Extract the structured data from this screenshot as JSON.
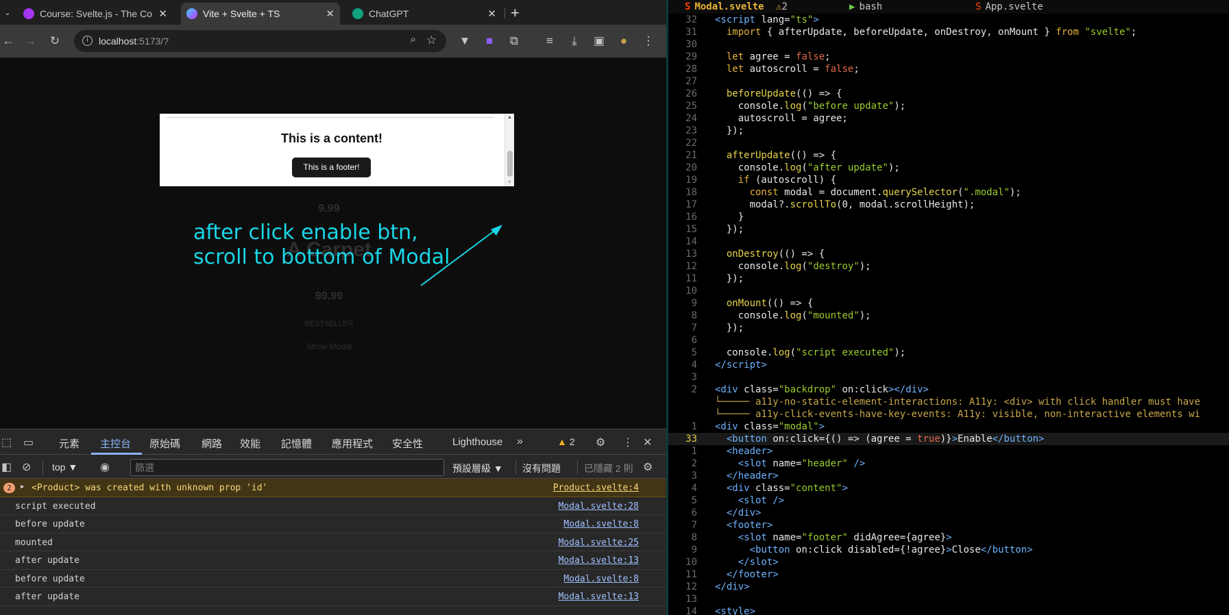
{
  "browser": {
    "tabs": [
      {
        "title": "Course: Svelte.js - The Co",
        "favicon_color": "#a435f0",
        "active": false
      },
      {
        "title": "Vite + Svelte + TS",
        "favicon_color": "#ff3e00",
        "active": true
      },
      {
        "title": "ChatGPT",
        "favicon_color": "#10a37f",
        "active": false
      }
    ],
    "url_host": "localhost",
    "url_rest": ":5173/?"
  },
  "page": {
    "bg_price_1": "9.99",
    "bg_title": "A Carpet",
    "bg_price_2": "99.99",
    "bg_badge": "BESTSELLER",
    "bg_show_modal": "Show Modal",
    "modal_content": "This is a content!",
    "modal_footer_button": "This is a footer!",
    "annotation_line1": "after click enable btn,",
    "annotation_line2": "scroll to bottom of Modal",
    "annotation_color": "#1ad6e6"
  },
  "devtools": {
    "tabs": [
      "元素",
      "主控台",
      "原始碼",
      "網路",
      "效能",
      "記憶體",
      "應用程式",
      "安全性",
      "Lighthouse"
    ],
    "active_tab": "主控台",
    "warnings_count": "2",
    "context": "top",
    "filter_placeholder": "篩選",
    "levels": "預設層級",
    "no_issues": "沒有問題",
    "hidden": "已隱藏 2 則",
    "logs": [
      {
        "msg": "<Product> was created with unknown prop 'id'",
        "src": "Product.svelte:4",
        "type": "warn",
        "count": "2"
      },
      {
        "msg": "script executed",
        "src": "Modal.svelte:28"
      },
      {
        "msg": "before update",
        "src": "Modal.svelte:8"
      },
      {
        "msg": "mounted",
        "src": "Modal.svelte:25"
      },
      {
        "msg": "after update",
        "src": "Modal.svelte:13"
      },
      {
        "msg": "before update",
        "src": "Modal.svelte:8"
      },
      {
        "msg": "after update",
        "src": "Modal.svelte:13"
      }
    ]
  },
  "editor": {
    "tmux": {
      "file1": "Modal.svelte",
      "file1_warn": "2",
      "file2": "bash",
      "file3": "App.svelte"
    },
    "lines": [
      {
        "n": "32",
        "html": "<span class='t'>&lt;script</span> <span class='a'>lang=</span><span class='s'>\"ts\"</span><span class='t'>&gt;</span>"
      },
      {
        "n": "31",
        "html": "  <span class='k'>import</span> { afterUpdate, beforeUpdate, onDestroy, onMount } <span class='k'>from</span> <span class='s'>\"svelte\"</span>;"
      },
      {
        "n": "30",
        "html": ""
      },
      {
        "n": "29",
        "html": "  <span class='k'>let</span> agree = <span class='b'>false</span>;"
      },
      {
        "n": "28",
        "html": "  <span class='k'>let</span> autoscroll = <span class='b'>false</span>;"
      },
      {
        "n": "27",
        "html": ""
      },
      {
        "n": "26",
        "html": "  <span class='f'>beforeUpdate</span>(() =&gt; {"
      },
      {
        "n": "25",
        "html": "    console.<span class='f'>log</span>(<span class='s'>\"before update\"</span>);"
      },
      {
        "n": "24",
        "html": "    autoscroll = agree;"
      },
      {
        "n": "23",
        "html": "  });"
      },
      {
        "n": "22",
        "html": ""
      },
      {
        "n": "21",
        "html": "  <span class='f'>afterUpdate</span>(() =&gt; {"
      },
      {
        "n": "20",
        "html": "    console.<span class='f'>log</span>(<span class='s'>\"after update\"</span>);"
      },
      {
        "n": "19",
        "html": "    <span class='k'>if</span> (autoscroll) {"
      },
      {
        "n": "18",
        "html": "      <span class='k'>const</span> modal = document.<span class='f'>querySelector</span>(<span class='s'>\".modal\"</span>);"
      },
      {
        "n": "17",
        "html": "      modal?.<span class='f'>scrollTo</span>(0, modal.scrollHeight);"
      },
      {
        "n": "16",
        "html": "    }"
      },
      {
        "n": "15",
        "html": "  });"
      },
      {
        "n": "14",
        "html": ""
      },
      {
        "n": "13",
        "html": "  <span class='f'>onDestroy</span>(() =&gt; {"
      },
      {
        "n": "12",
        "html": "    console.<span class='f'>log</span>(<span class='s'>\"destroy\"</span>);"
      },
      {
        "n": "11",
        "html": "  });"
      },
      {
        "n": "10",
        "html": ""
      },
      {
        "n": "9",
        "html": "  <span class='f'>onMount</span>(() =&gt; {"
      },
      {
        "n": "8",
        "html": "    console.<span class='f'>log</span>(<span class='s'>\"mounted\"</span>);"
      },
      {
        "n": "7",
        "html": "  });"
      },
      {
        "n": "6",
        "html": ""
      },
      {
        "n": "5",
        "html": "  console.<span class='f'>log</span>(<span class='s'>\"script executed\"</span>);"
      },
      {
        "n": "4",
        "html": "<span class='t'>&lt;/script&gt;</span>"
      },
      {
        "n": "3",
        "html": ""
      },
      {
        "n": "2",
        "html": "<span class='t'>&lt;div</span> <span class='a'>class=</span><span class='s'>\"backdrop\"</span> <span class='a'>on:click</span><span class='t'>&gt;&lt;/div&gt;</span>"
      },
      {
        "n": "",
        "html": "<span class='c'>└───── a11y-no-static-element-interactions: A11y: &lt;div&gt; with click handler must have</span>"
      },
      {
        "n": "",
        "html": "<span class='c'>└───── a11y-click-events-have-key-events: A11y: visible, non-interactive elements wi</span>"
      },
      {
        "n": "1",
        "html": "<span class='t'>&lt;div</span> <span class='a'>class=</span><span class='s'>\"modal\"</span><span class='t'>&gt;</span>"
      },
      {
        "n": "33",
        "html": "  <span class='t'>&lt;button</span> <span class='a'>on:click=</span>{() =&gt; (agree = <span class='b'>true</span>)}<span class='t'>&gt;</span>Enable<span class='t'>&lt;/button&gt;</span>",
        "cur": true
      },
      {
        "n": "1",
        "html": "  <span class='t'>&lt;header&gt;</span>"
      },
      {
        "n": "2",
        "html": "    <span class='t'>&lt;slot</span> <span class='a'>name=</span><span class='s'>\"header\"</span> <span class='t'>/&gt;</span>"
      },
      {
        "n": "3",
        "html": "  <span class='t'>&lt;/header&gt;</span>"
      },
      {
        "n": "4",
        "html": "  <span class='t'>&lt;div</span> <span class='a'>class=</span><span class='s'>\"content\"</span><span class='t'>&gt;</span>"
      },
      {
        "n": "5",
        "html": "    <span class='t'>&lt;slot /&gt;</span>"
      },
      {
        "n": "6",
        "html": "  <span class='t'>&lt;/div&gt;</span>"
      },
      {
        "n": "7",
        "html": "  <span class='t'>&lt;footer&gt;</span>"
      },
      {
        "n": "8",
        "html": "    <span class='t'>&lt;slot</span> <span class='a'>name=</span><span class='s'>\"footer\"</span> <span class='a'>didAgree=</span>{agree}<span class='t'>&gt;</span>"
      },
      {
        "n": "9",
        "html": "      <span class='t'>&lt;button</span> <span class='a'>on:click disabled=</span>{!agree}<span class='t'>&gt;</span>Close<span class='t'>&lt;/button&gt;</span>"
      },
      {
        "n": "10",
        "html": "    <span class='t'>&lt;/slot&gt;</span>"
      },
      {
        "n": "11",
        "html": "  <span class='t'>&lt;/footer&gt;</span>"
      },
      {
        "n": "12",
        "html": "<span class='t'>&lt;/div&gt;</span>"
      },
      {
        "n": "13",
        "html": ""
      },
      {
        "n": "14",
        "html": "<span class='t'>&lt;style&gt;</span>"
      }
    ]
  }
}
